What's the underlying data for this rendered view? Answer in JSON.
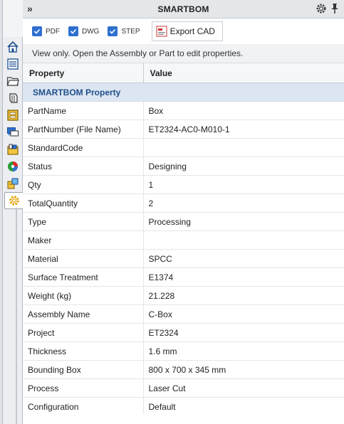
{
  "panel": {
    "title": "SMARTBOM",
    "expand_glyph": "»",
    "gear_icon": "gear-icon",
    "pin_icon": "pin-icon"
  },
  "toolbar": {
    "checkboxes": [
      {
        "label": "PDF",
        "checked": true
      },
      {
        "label": "DWG",
        "checked": true
      },
      {
        "label": "STEP",
        "checked": true
      }
    ],
    "export_label": "Export CAD"
  },
  "info_text": "View only. Open the Assembly or Part to edit properties.",
  "table": {
    "headers": [
      "Property",
      "Value"
    ],
    "group_label": "SMARTBOM Property",
    "rows": [
      {
        "property": "PartName",
        "value": "Box"
      },
      {
        "property": "PartNumber (File Name)",
        "value": "ET2324-AC0-M010-1"
      },
      {
        "property": "StandardCode",
        "value": ""
      },
      {
        "property": "Status",
        "value": "Designing"
      },
      {
        "property": "Qty",
        "value": "1"
      },
      {
        "property": "TotalQuantity",
        "value": "2"
      },
      {
        "property": "Type",
        "value": "Processing"
      },
      {
        "property": "Maker",
        "value": ""
      },
      {
        "property": "Material",
        "value": "SPCC"
      },
      {
        "property": "Surface Treatment",
        "value": "E1374"
      },
      {
        "property": "Weight (kg)",
        "value": "21.228"
      },
      {
        "property": "Assembly Name",
        "value": "C-Box"
      },
      {
        "property": "Project",
        "value": "ET2324"
      },
      {
        "property": "Thickness",
        "value": "1.6 mm"
      },
      {
        "property": "Bounding Box",
        "value": "800 x 700 x 345 mm"
      },
      {
        "property": "Process",
        "value": "Laser Cut"
      },
      {
        "property": "Configuration",
        "value": "Default"
      }
    ]
  },
  "sidebar_icons": [
    "home-icon",
    "feature-tree-icon",
    "folder-icon",
    "parts-icon",
    "properties-icon",
    "comments-icon",
    "design-library-icon",
    "appearance-icon",
    "custom-properties-icon",
    "smartbom-icon"
  ],
  "colors": {
    "accent": "#2f6fcf",
    "group_bg": "#dce6f2",
    "group_text": "#1f4f8a"
  }
}
